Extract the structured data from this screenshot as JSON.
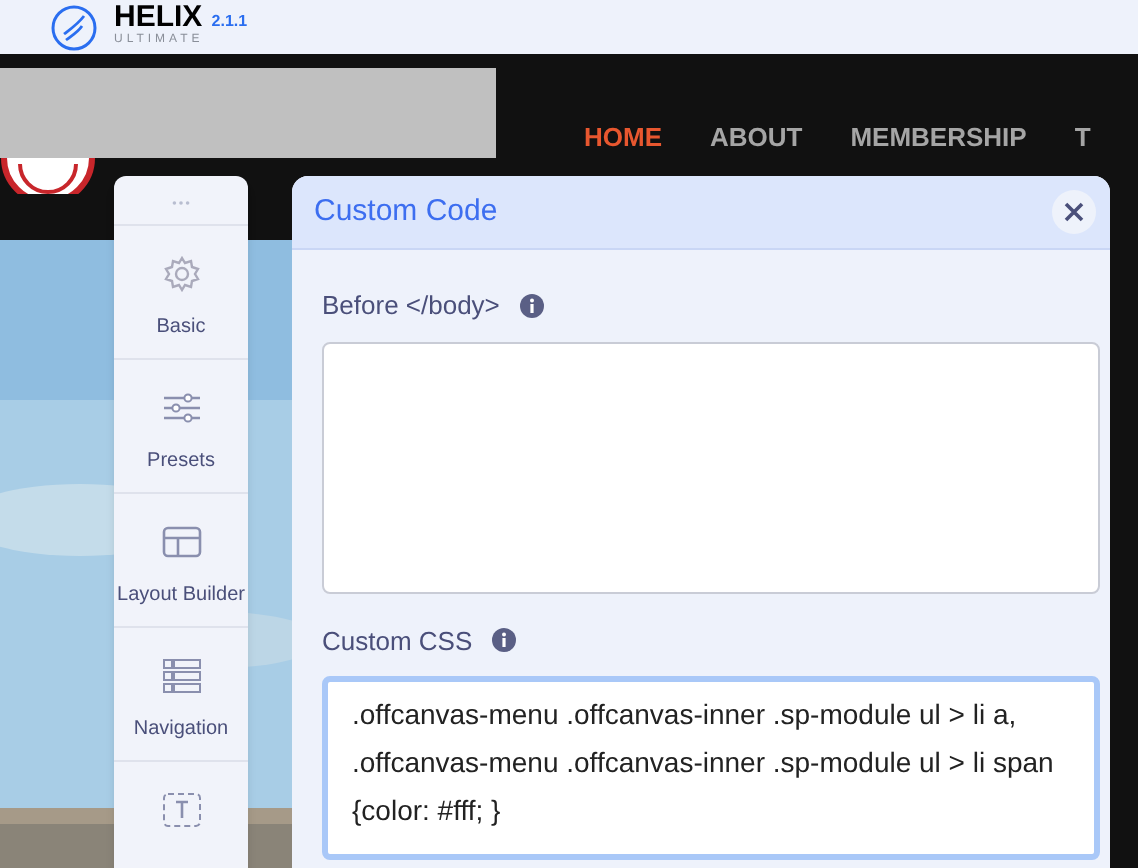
{
  "app": {
    "name": "HELIX",
    "subtitle": "ULTIMATE",
    "version": "2.1.1"
  },
  "site_nav": [
    {
      "label": "HOME",
      "selected": true
    },
    {
      "label": "ABOUT",
      "selected": false
    },
    {
      "label": "MEMBERSHIP",
      "selected": false
    },
    {
      "label": "T",
      "selected": false
    }
  ],
  "sidebar": {
    "items": [
      {
        "label": "Basic"
      },
      {
        "label": "Presets"
      },
      {
        "label": "Layout Builder"
      },
      {
        "label": "Navigation"
      },
      {
        "kind": "icon_only"
      }
    ]
  },
  "dialog": {
    "title": "Custom Code",
    "fields": [
      {
        "label": "Before </body>",
        "focused": false
      },
      {
        "label": "Custom CSS",
        "value": ".offcanvas-menu .offcanvas-inner .sp-module ul > li a, .offcanvas-menu .offcanvas-inner .sp-module ul > li span {color: #fff; }",
        "focused": true
      }
    ]
  }
}
